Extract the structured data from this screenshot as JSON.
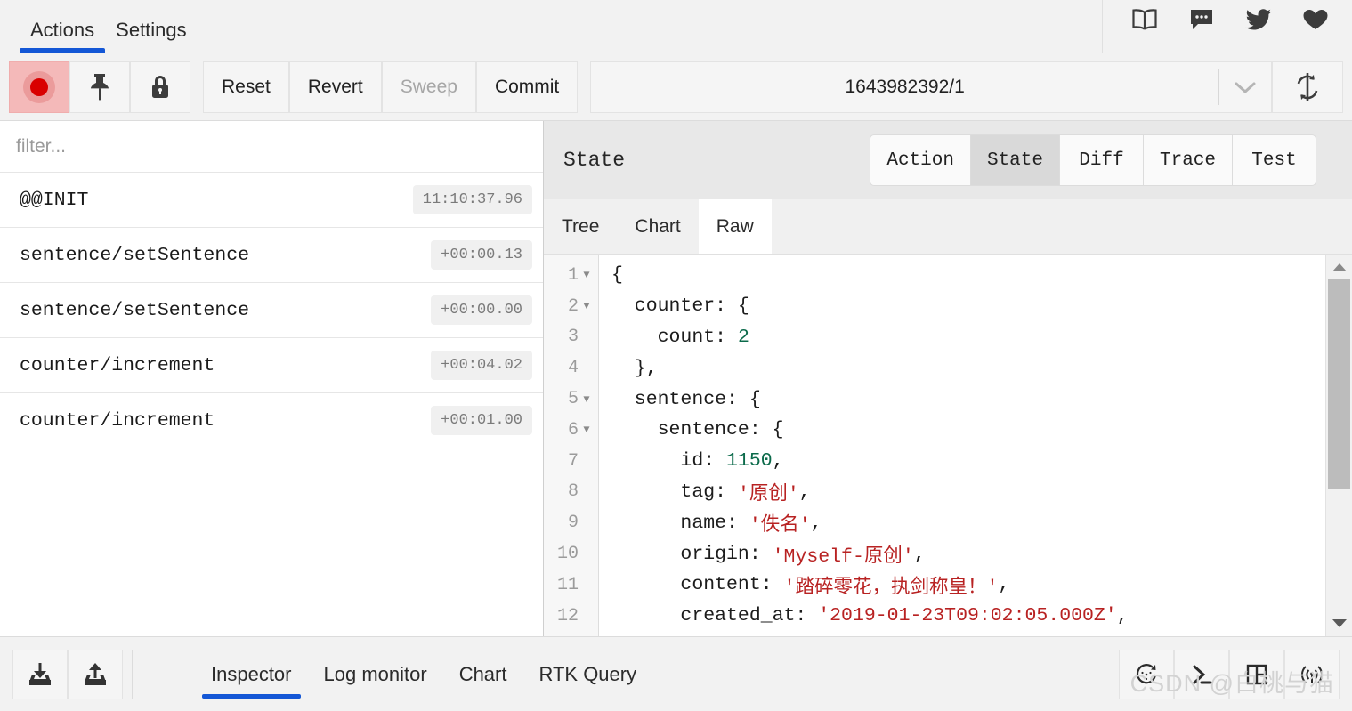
{
  "header": {
    "tabs": [
      {
        "label": "Actions",
        "active": true
      },
      {
        "label": "Settings",
        "active": false
      }
    ],
    "icons": [
      {
        "name": "book-icon"
      },
      {
        "name": "chat-bubble-icon"
      },
      {
        "name": "twitter-icon"
      },
      {
        "name": "heart-icon"
      }
    ]
  },
  "toolbar": {
    "record_label": "",
    "pin_label": "",
    "lock_label": "",
    "reset_label": "Reset",
    "revert_label": "Revert",
    "sweep_label": "Sweep",
    "commit_label": "Commit",
    "instance_value": "1643982392/1",
    "sweep_disabled": true
  },
  "actions_panel": {
    "filter_placeholder": "filter...",
    "rows": [
      {
        "name": "@@INIT",
        "time": "11:10:37.96"
      },
      {
        "name": "sentence/setSentence",
        "time": "+00:00.13"
      },
      {
        "name": "sentence/setSentence",
        "time": "+00:00.00"
      },
      {
        "name": "counter/increment",
        "time": "+00:04.02"
      },
      {
        "name": "counter/increment",
        "time": "+00:01.00"
      }
    ]
  },
  "inspector": {
    "title": "State",
    "tabs": [
      {
        "label": "Action",
        "active": false
      },
      {
        "label": "State",
        "active": true
      },
      {
        "label": "Diff",
        "active": false
      },
      {
        "label": "Trace",
        "active": false
      },
      {
        "label": "Test",
        "active": false
      }
    ],
    "sub_tabs": [
      {
        "label": "Tree",
        "active": false
      },
      {
        "label": "Chart",
        "active": false
      },
      {
        "label": "Raw",
        "active": true
      }
    ],
    "code_lines": [
      {
        "n": "1",
        "fold": true,
        "segments": [
          {
            "t": "{",
            "k": "plain"
          }
        ]
      },
      {
        "n": "2",
        "fold": true,
        "segments": [
          {
            "t": "  counter: {",
            "k": "plain"
          }
        ]
      },
      {
        "n": "3",
        "fold": false,
        "segments": [
          {
            "t": "    count: ",
            "k": "plain"
          },
          {
            "t": "2",
            "k": "num"
          }
        ]
      },
      {
        "n": "4",
        "fold": false,
        "segments": [
          {
            "t": "  },",
            "k": "plain"
          }
        ]
      },
      {
        "n": "5",
        "fold": true,
        "segments": [
          {
            "t": "  sentence: {",
            "k": "plain"
          }
        ]
      },
      {
        "n": "6",
        "fold": true,
        "segments": [
          {
            "t": "    sentence: {",
            "k": "plain"
          }
        ]
      },
      {
        "n": "7",
        "fold": false,
        "segments": [
          {
            "t": "      id: ",
            "k": "plain"
          },
          {
            "t": "1150",
            "k": "num"
          },
          {
            "t": ",",
            "k": "plain"
          }
        ]
      },
      {
        "n": "8",
        "fold": false,
        "segments": [
          {
            "t": "      tag: ",
            "k": "plain"
          },
          {
            "t": "'原创'",
            "k": "str"
          },
          {
            "t": ",",
            "k": "plain"
          }
        ]
      },
      {
        "n": "9",
        "fold": false,
        "segments": [
          {
            "t": "      name: ",
            "k": "plain"
          },
          {
            "t": "'佚名'",
            "k": "str"
          },
          {
            "t": ",",
            "k": "plain"
          }
        ]
      },
      {
        "n": "10",
        "fold": false,
        "segments": [
          {
            "t": "      origin: ",
            "k": "plain"
          },
          {
            "t": "'Myself-原创'",
            "k": "str"
          },
          {
            "t": ",",
            "k": "plain"
          }
        ]
      },
      {
        "n": "11",
        "fold": false,
        "segments": [
          {
            "t": "      content: ",
            "k": "plain"
          },
          {
            "t": "'踏碎零花，执剑称皇！'",
            "k": "str"
          },
          {
            "t": ",",
            "k": "plain"
          }
        ]
      },
      {
        "n": "12",
        "fold": false,
        "segments": [
          {
            "t": "      created_at: ",
            "k": "plain"
          },
          {
            "t": "'2019-01-23T09:02:05.000Z'",
            "k": "str"
          },
          {
            "t": ",",
            "k": "plain"
          }
        ]
      }
    ]
  },
  "footer": {
    "import_label": "",
    "export_label": "",
    "tabs": [
      {
        "label": "Inspector",
        "active": true
      },
      {
        "label": "Log monitor",
        "active": false
      },
      {
        "label": "Chart",
        "active": false
      },
      {
        "label": "RTK Query",
        "active": false
      }
    ],
    "icons": [
      {
        "name": "dispatcher-icon"
      },
      {
        "name": "console-icon"
      },
      {
        "name": "layout-icon"
      },
      {
        "name": "remote-icon"
      }
    ],
    "watermark": "CSDN @白桃与猫"
  },
  "colors": {
    "accent": "#1457d6",
    "record": "#d90000",
    "string": "#b82222",
    "number": "#0b6a4a"
  }
}
